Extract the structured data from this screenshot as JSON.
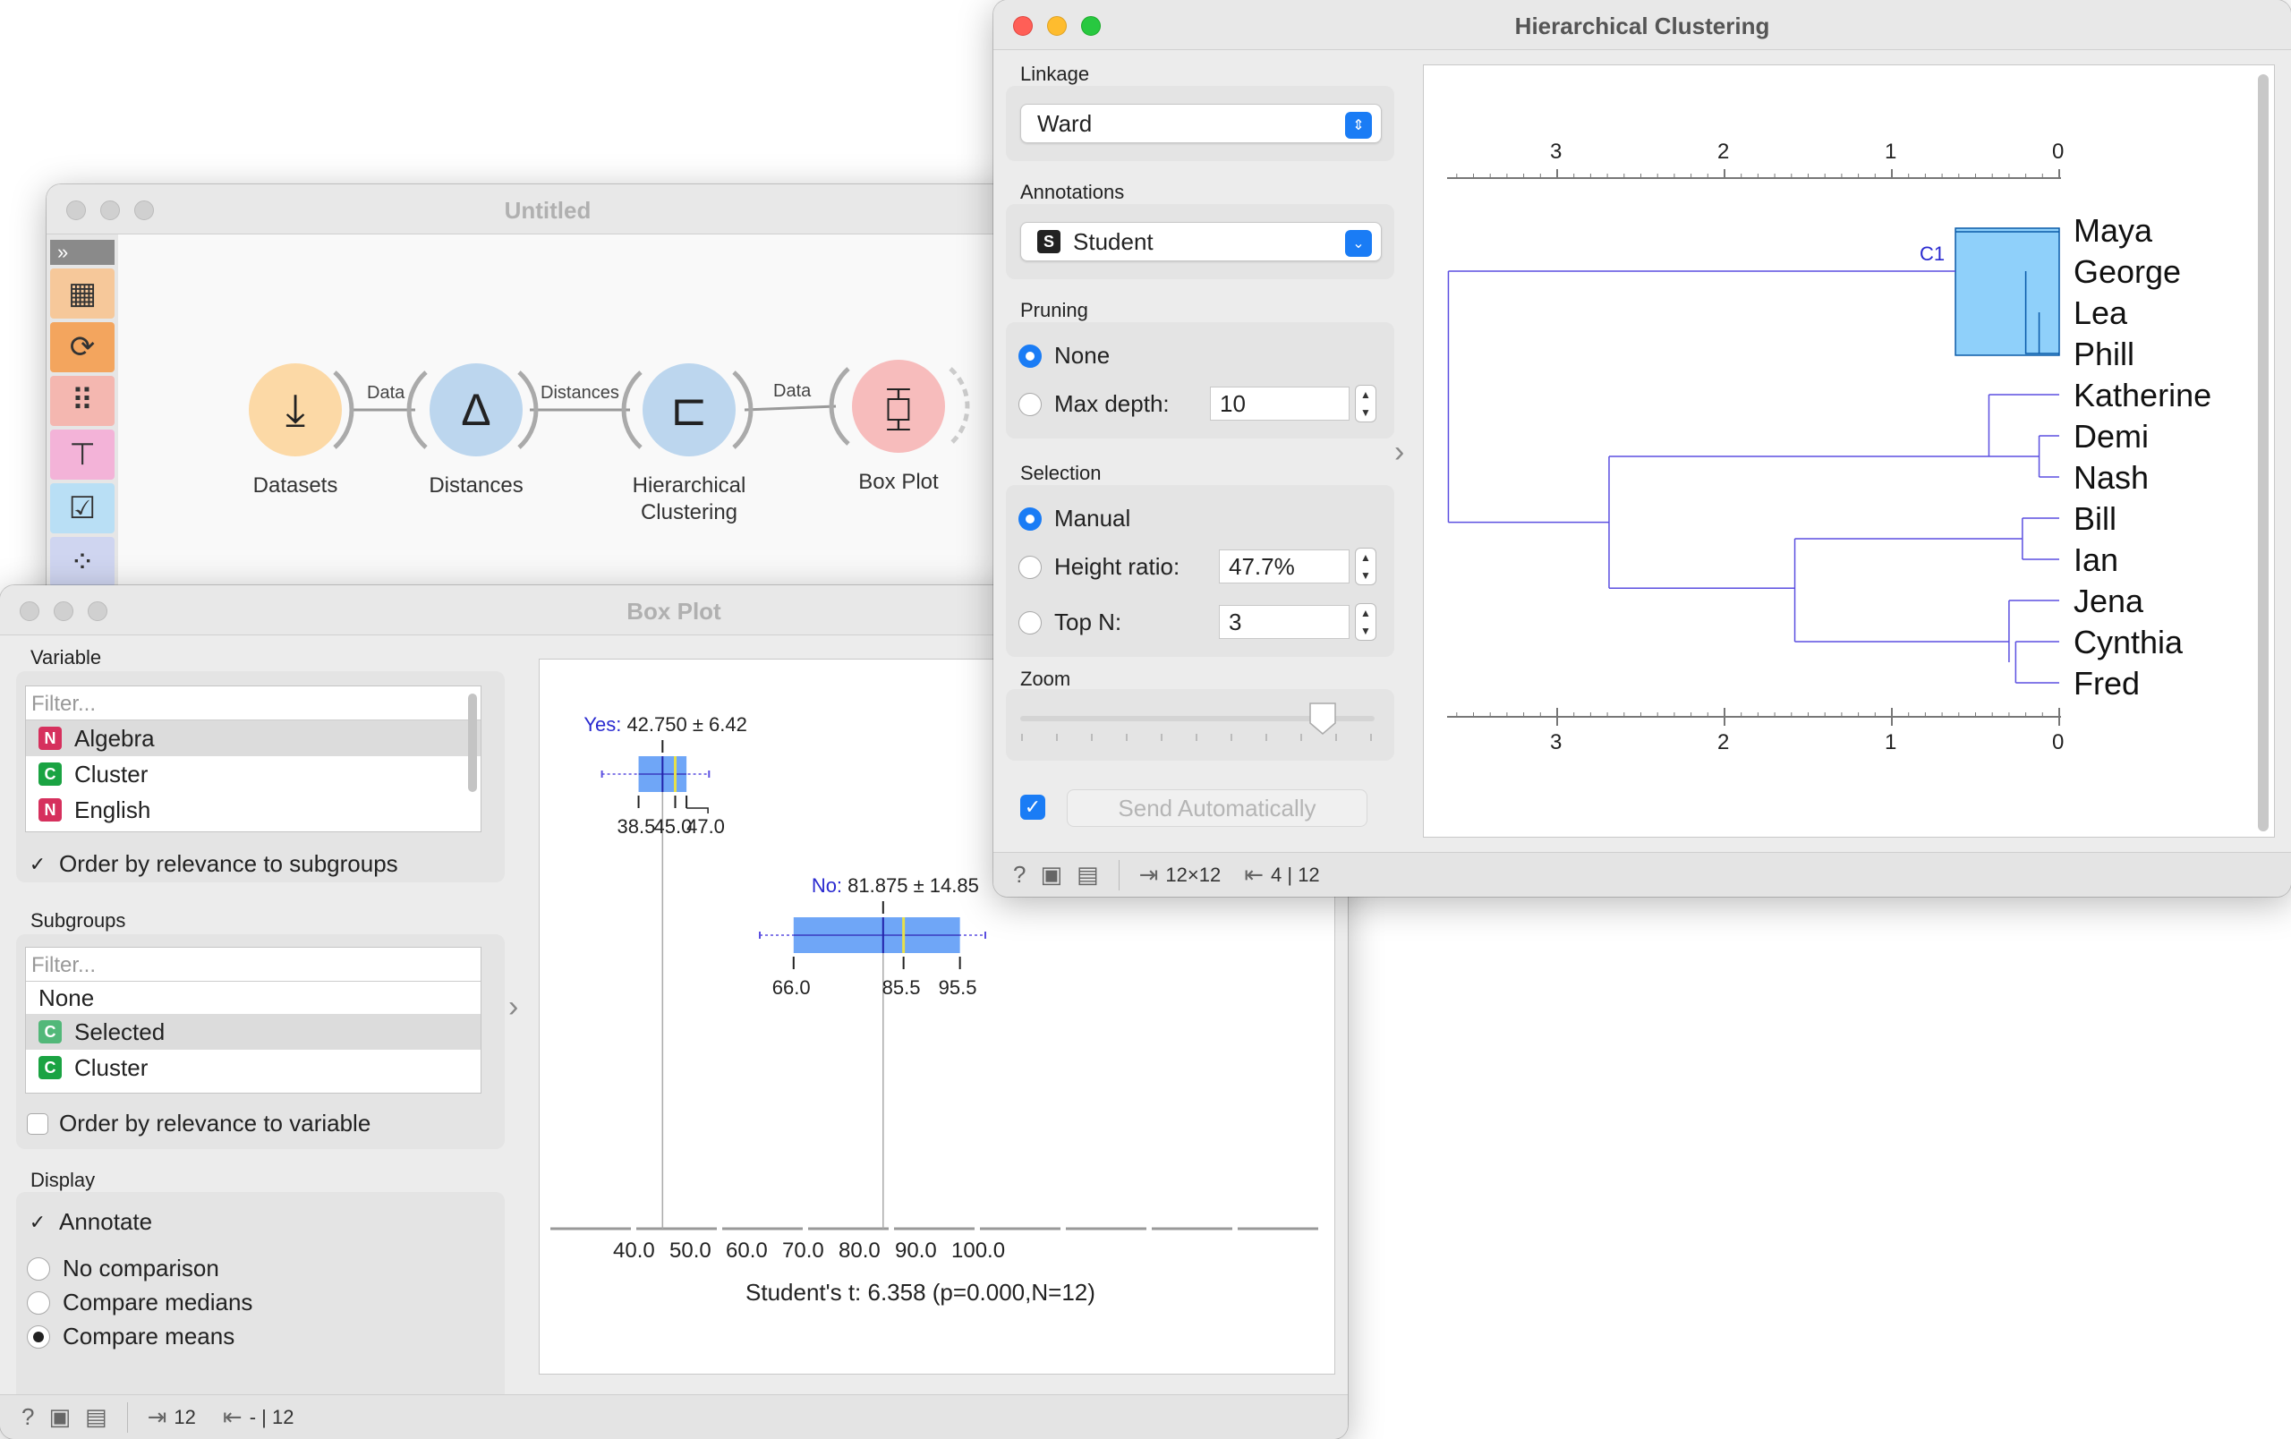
{
  "untitled": {
    "title": "Untitled",
    "nodes": [
      {
        "label": "Datasets"
      },
      {
        "label": "Distances"
      },
      {
        "label": "Hierarchical\nClustering"
      },
      {
        "label": "Box Plot"
      }
    ],
    "links": [
      "Data",
      "Distances",
      "Data"
    ]
  },
  "boxplot": {
    "title": "Box Plot",
    "variable_label": "Variable",
    "filter_placeholder": "Filter...",
    "variables": [
      {
        "badge": "N",
        "name": "Algebra"
      },
      {
        "badge": "C",
        "name": "Cluster"
      },
      {
        "badge": "N",
        "name": "English"
      }
    ],
    "order_subgroups": "Order by relevance to subgroups",
    "subgroups_label": "Subgroups",
    "subgroups": [
      {
        "badge": "",
        "name": "None"
      },
      {
        "badge": "C",
        "name": "Selected"
      },
      {
        "badge": "C",
        "name": "Cluster"
      }
    ],
    "order_variable": "Order by relevance to variable",
    "display_label": "Display",
    "annotate": "Annotate",
    "no_comparison": "No comparison",
    "compare_medians": "Compare medians",
    "compare_means": "Compare means",
    "status_in": "12",
    "status_out": "- | 12",
    "plot": {
      "groups": [
        {
          "name": "Yes:",
          "summary": "42.750 ± 6.42",
          "q1": 38.5,
          "median": 45.0,
          "q3": 47.0,
          "mean": 42.75,
          "whisker_lo": 32.0,
          "whisker_hi": 51.0,
          "labels": [
            "38.5",
            "45.0",
            "47.0"
          ]
        },
        {
          "name": "No:",
          "summary": "81.875 ± 14.85",
          "q1": 66.0,
          "median": 85.5,
          "q3": 95.5,
          "mean": 81.875,
          "whisker_lo": 60.0,
          "whisker_hi": 100.0,
          "labels": [
            "66.0",
            "85.5",
            "95.5"
          ]
        }
      ],
      "ticks": [
        "40.0",
        "50.0",
        "60.0",
        "70.0",
        "80.0",
        "90.0",
        "100.0"
      ],
      "stat": "Student's t: 6.358 (p=0.000,N=12)"
    }
  },
  "hc": {
    "title": "Hierarchical Clustering",
    "linkage_label": "Linkage",
    "linkage_value": "Ward",
    "annotations_label": "Annotations",
    "annotations_badge": "S",
    "annotations_value": "Student",
    "pruning_label": "Pruning",
    "pruning_none": "None",
    "pruning_maxdepth": "Max depth:",
    "maxdepth_value": "10",
    "selection_label": "Selection",
    "sel_manual": "Manual",
    "sel_height": "Height ratio:",
    "height_value": "47.7%",
    "sel_topn": "Top N:",
    "topn_value": "3",
    "zoom_label": "Zoom",
    "send_auto": "Send Automatically",
    "status_in": "12×12",
    "status_out": "4 | 12",
    "axis_ticks": [
      "3",
      "2",
      "1",
      "0"
    ],
    "cluster_label": "C1",
    "leaves": [
      "Maya",
      "George",
      "Lea",
      "Phill",
      "Katherine",
      "Demi",
      "Nash",
      "Bill",
      "Ian",
      "Jena",
      "Cynthia",
      "Fred"
    ]
  },
  "colors": {
    "accent": "#1a7cf5",
    "dendro": "#5b4fe0",
    "box": "#6fa6f7",
    "selected": "#8fd0fa"
  }
}
